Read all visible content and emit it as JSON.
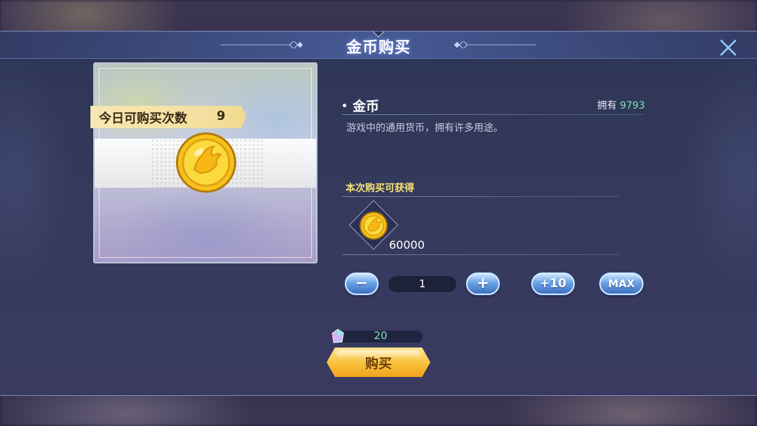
{
  "dialog": {
    "title": "金币购买",
    "close_icon": "close-icon"
  },
  "item": {
    "daily_limit_label": "今日可购买次数",
    "daily_limit_value": "9",
    "name": "金币",
    "owned_label": "拥有",
    "owned_value": "9793",
    "description": "游戏中的通用货币，拥有许多用途。",
    "icon": "gold-coin-icon"
  },
  "reward": {
    "section_label": "本次购买可获得",
    "icon": "gold-coin-icon",
    "quantity": "60000"
  },
  "quantity_controls": {
    "minus_label": "−",
    "value": "1",
    "plus_label": "+",
    "plus10_label": "+10",
    "max_label": "MAX"
  },
  "purchase": {
    "cost_icon": "gem-icon",
    "cost_value": "20",
    "buy_label": "购买"
  },
  "colors": {
    "accent_green": "#7de3b1",
    "accent_yellow": "#f6e27a",
    "button_blue": "#6aa3e6",
    "buy_gold": "#f9c440"
  }
}
